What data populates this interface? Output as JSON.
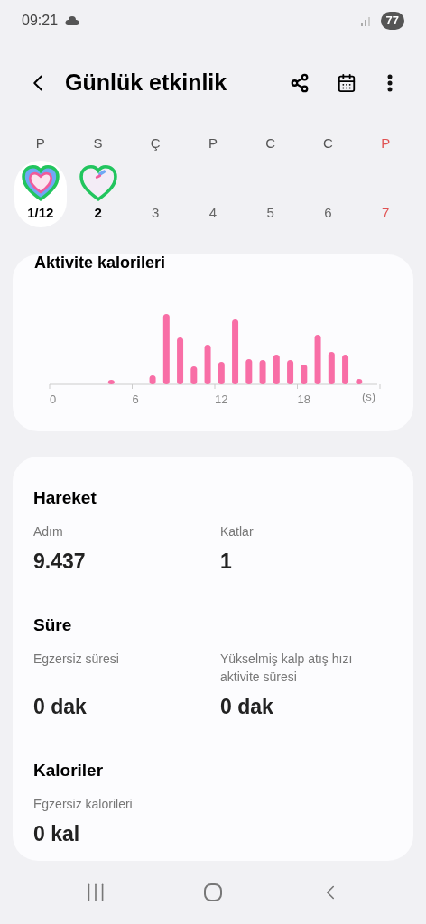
{
  "status_bar": {
    "time": "09:21",
    "battery": "77"
  },
  "header": {
    "title": "Günlük etkinlik"
  },
  "week": [
    {
      "weekday": "P",
      "date": "1/12",
      "selected": true,
      "kind": "closed",
      "weekend": false,
      "has_data": true
    },
    {
      "weekday": "S",
      "date": "2",
      "selected": false,
      "kind": "open",
      "weekend": false,
      "has_data": true
    },
    {
      "weekday": "Ç",
      "date": "3",
      "selected": false,
      "kind": "empty",
      "weekend": false,
      "has_data": false
    },
    {
      "weekday": "P",
      "date": "4",
      "selected": false,
      "kind": "empty",
      "weekend": false,
      "has_data": false
    },
    {
      "weekday": "C",
      "date": "5",
      "selected": false,
      "kind": "empty",
      "weekend": false,
      "has_data": false
    },
    {
      "weekday": "C",
      "date": "6",
      "selected": false,
      "kind": "empty",
      "weekend": false,
      "has_data": false
    },
    {
      "weekday": "P",
      "date": "7",
      "selected": false,
      "kind": "empty",
      "weekend": true,
      "has_data": false
    }
  ],
  "calories_card": {
    "title": "Aktivite kalorileri",
    "x_tick_labels": [
      "0",
      "6",
      "12",
      "18"
    ],
    "unit": "(s)"
  },
  "summary": {
    "sections": [
      {
        "title": "Hareket",
        "metrics": [
          {
            "label": "Adım",
            "value": "9.437"
          },
          {
            "label": "Katlar",
            "value": "1"
          }
        ]
      },
      {
        "title": "Süre",
        "metrics": [
          {
            "label": "Egzersiz süresi",
            "value": "0 dak"
          },
          {
            "label": "Yükselmiş kalp atış hızı aktivite süresi",
            "value": "0 dak"
          }
        ]
      },
      {
        "title": "Kaloriler",
        "metrics": [
          {
            "label": "Egzersiz kalorileri",
            "value": "0 kal"
          }
        ]
      }
    ]
  }
}
